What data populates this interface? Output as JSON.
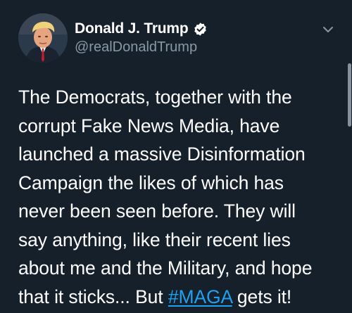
{
  "tweet": {
    "author": {
      "display_name": "Donald J. Trump",
      "handle": "@realDonaldTrump",
      "verified": true,
      "avatar_icon": "profile-photo"
    },
    "menu_icon": "chevron-down-icon",
    "text_before_hashtag": "The Democrats, together with the\ncorrupt Fake News Media, have\nlaunched a massive Disinformation\nCampaign the likes of which has\nnever been seen before. They will\nsay anything, like their recent lies\nabout me and the Military, and hope\nthat it sticks... But ",
    "hashtag": "#MAGA",
    "text_after_hashtag": " gets it!"
  },
  "colors": {
    "background": "#15202b",
    "text": "#ffffff",
    "secondary_text": "#8899a6",
    "link": "#1da1f2"
  }
}
